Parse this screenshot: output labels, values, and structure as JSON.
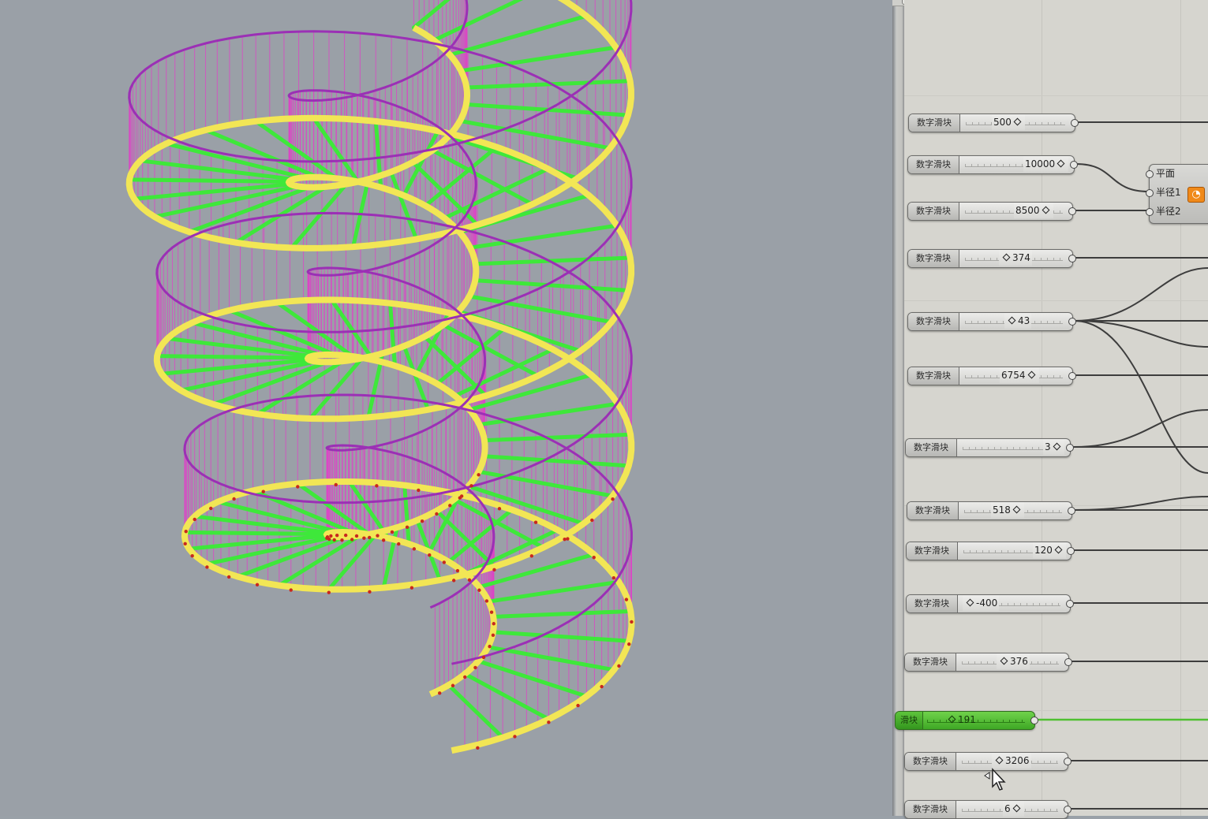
{
  "app": {
    "left_pane": "rhino-viewport",
    "right_pane": "grasshopper-canvas"
  },
  "sliders": [
    {
      "label": "数字滑块",
      "value": "500",
      "id": "s1"
    },
    {
      "label": "数字滑块",
      "value": "10000",
      "id": "s2"
    },
    {
      "label": "数字滑块",
      "value": "8500",
      "id": "s3"
    },
    {
      "label": "数字滑块",
      "value": "374",
      "id": "s4"
    },
    {
      "label": "数字滑块",
      "value": "43",
      "id": "s5"
    },
    {
      "label": "数字滑块",
      "value": "6754",
      "id": "s6"
    },
    {
      "label": "数字滑块",
      "value": "3",
      "id": "s7"
    },
    {
      "label": "数字滑块",
      "value": "518",
      "id": "s8"
    },
    {
      "label": "数字滑块",
      "value": "120",
      "id": "s9"
    },
    {
      "label": "数字滑块",
      "value": "-400",
      "id": "s10"
    },
    {
      "label": "数字滑块",
      "value": "376",
      "id": "s11"
    },
    {
      "label": "滑块",
      "value": "191",
      "id": "s12",
      "selected": true
    },
    {
      "label": "数字滑块",
      "value": "3206",
      "id": "s13"
    },
    {
      "label": "数字滑块",
      "value": "6",
      "id": "s14"
    }
  ],
  "component": {
    "inputs": [
      "平面",
      "半径1",
      "半径2"
    ],
    "icon": "arc-component-icon"
  },
  "colors": {
    "viewport_bg": "#9aa0a7",
    "canvas_bg": "#d6d5cf",
    "stair_rail": "#9b30b5",
    "balusters": "#e040c8",
    "treads": "#3ee83a",
    "stringer": "#f2e655",
    "stringer_lower": "#c8281e",
    "selected_slider": "#4fbf31"
  }
}
